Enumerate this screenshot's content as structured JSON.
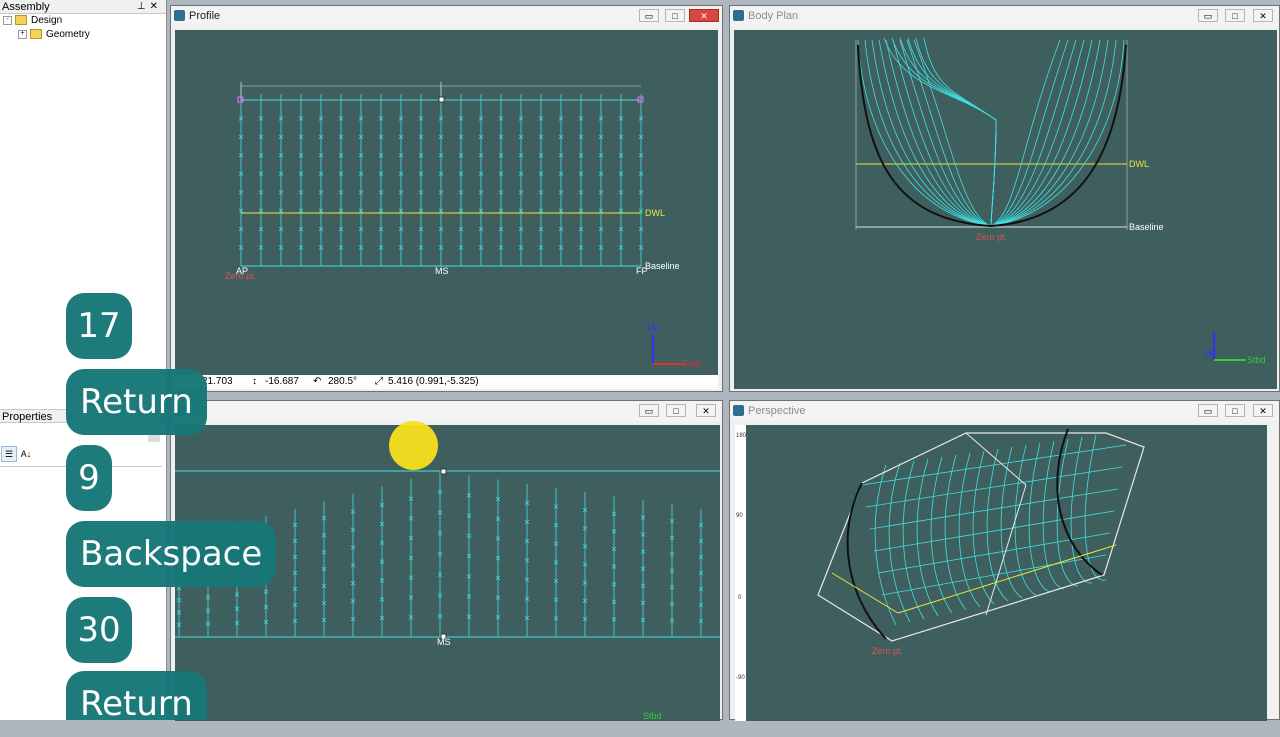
{
  "colors": {
    "viewport_bg": "#3f5f5f",
    "station_line": "#40e0e0",
    "dwl_line": "#e6e640",
    "zero_label": "#e05050",
    "key_pill": "#177778",
    "cursor_dot": "#f6df1c"
  },
  "assembly": {
    "title": "Assembly",
    "pin_icon": "pin-icon",
    "close_icon": "close-icon",
    "tree": [
      {
        "label": "Design",
        "expander": "-"
      },
      {
        "label": "Geometry",
        "expander": "+"
      }
    ]
  },
  "properties": {
    "title": "Properties",
    "sort_category_icon": "categorized-icon",
    "sort_alpha_icon": "sort-alpha-icon"
  },
  "windows": {
    "profile": {
      "title": "Profile",
      "labels": {
        "dwl": "DWL",
        "baseline": "Baseline",
        "ap": "AP",
        "zero": "Zero pt.",
        "ms": "MS",
        "fp": "FP",
        "axis_up": "Up",
        "axis_fwd": "Fwd"
      },
      "status": {
        "x": "21.703",
        "y": "-16.687",
        "angle": "280.5°",
        "dist": "5.416 (0.991,-5.325)"
      }
    },
    "body_plan": {
      "title": "Body Plan",
      "labels": {
        "dwl": "DWL",
        "baseline": "Baseline",
        "zero": "Zero pt.",
        "axis_up": "Up",
        "axis_stbd": "Stbd"
      }
    },
    "plan": {
      "title": "an",
      "labels": {
        "ms": "MS",
        "axis_stbd": "Stbd"
      }
    },
    "perspective": {
      "title": "Perspective",
      "labels": {
        "zero": "Zero pt."
      },
      "ruler_ticks": [
        "180",
        "90",
        "0",
        "-90"
      ]
    }
  },
  "window_controls": {
    "minimize": "▭",
    "maximize": "□",
    "close": "✕"
  },
  "keystrokes": [
    "17",
    "Return",
    "9",
    "Backspace",
    "30",
    "Return"
  ]
}
